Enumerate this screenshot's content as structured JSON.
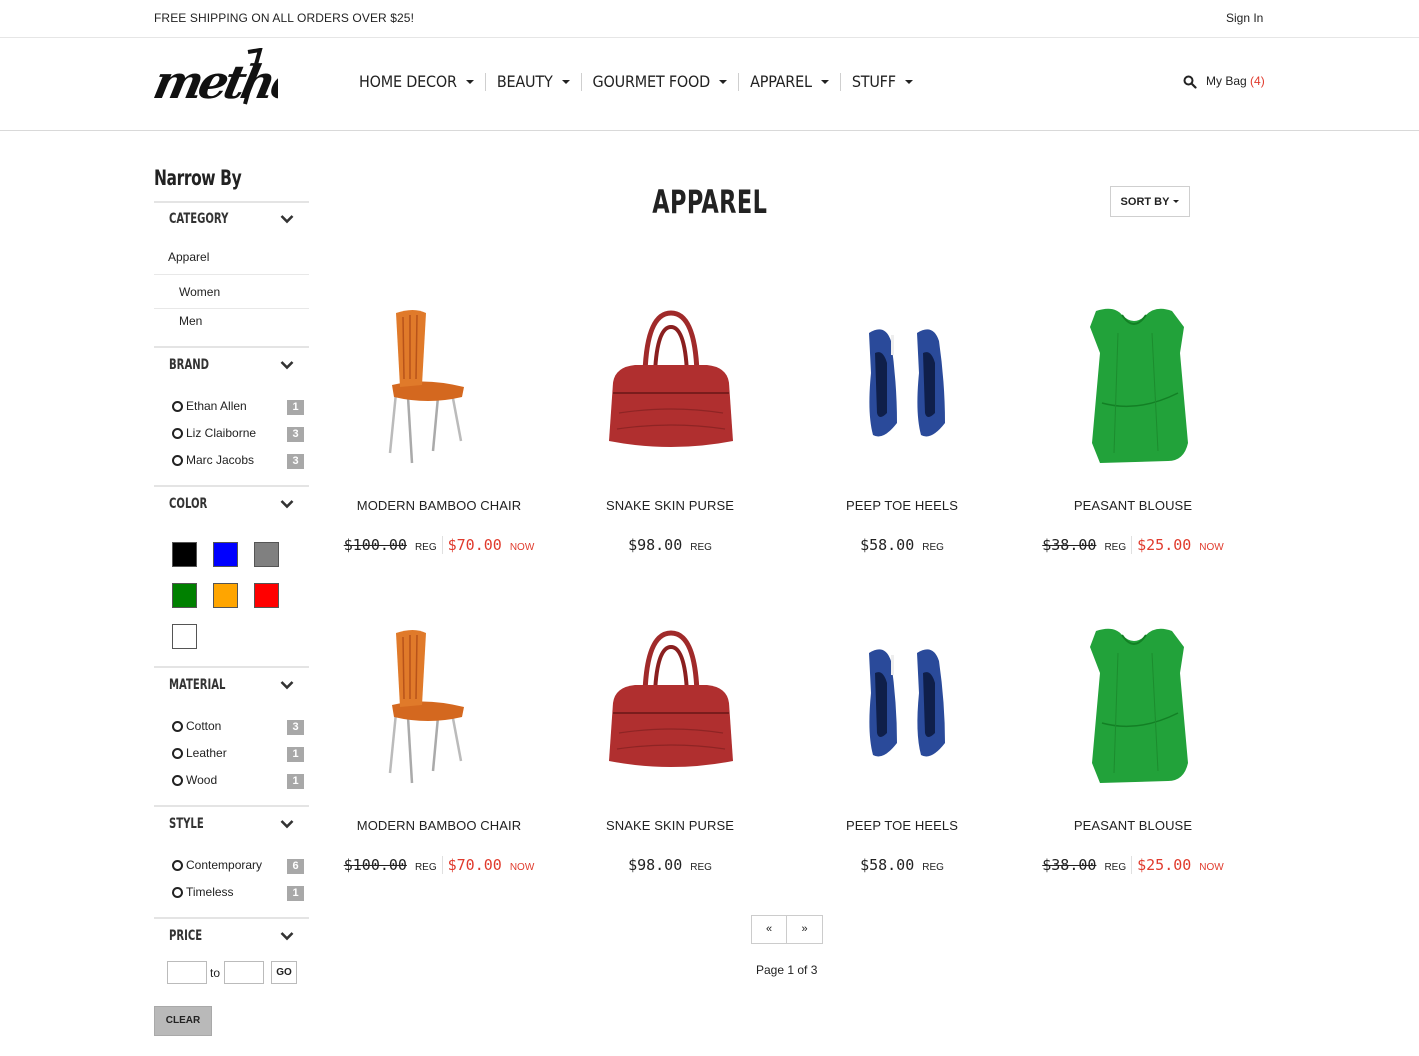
{
  "topbar": {
    "promo": "FREE SHIPPING ON ALL ORDERS OVER $25!",
    "signin": "Sign In"
  },
  "header": {
    "logo_text": "method",
    "nav": [
      "HOME DECOR",
      "BEAUTY",
      "GOURMET FOOD",
      "APPAREL",
      "STUFF"
    ],
    "bag_label": "My Bag",
    "bag_count": "(4)"
  },
  "sidebar": {
    "title": "Narrow By",
    "category": {
      "heading": "CATEGORY",
      "parent": "Apparel",
      "children": [
        "Women",
        "Men"
      ]
    },
    "brand": {
      "heading": "BRAND",
      "items": [
        {
          "label": "Ethan Allen",
          "count": "1"
        },
        {
          "label": "Liz Claiborne",
          "count": "3"
        },
        {
          "label": "Marc Jacobs",
          "count": "3"
        }
      ]
    },
    "color": {
      "heading": "COLOR",
      "swatches": [
        "#000000",
        "#0000ff",
        "#808080",
        "#008000",
        "#ffa500",
        "#ff0000",
        "#ffffff"
      ]
    },
    "material": {
      "heading": "MATERIAL",
      "items": [
        {
          "label": "Cotton",
          "count": "3"
        },
        {
          "label": "Leather",
          "count": "1"
        },
        {
          "label": "Wood",
          "count": "1"
        }
      ]
    },
    "style": {
      "heading": "STYLE",
      "items": [
        {
          "label": "Contemporary",
          "count": "6"
        },
        {
          "label": "Timeless",
          "count": "1"
        }
      ]
    },
    "price": {
      "heading": "PRICE",
      "to_label": "to",
      "go_label": "GO",
      "from_value": "",
      "to_value": ""
    },
    "clear_label": "CLEAR"
  },
  "main": {
    "title": "APPAREL",
    "sort_label": "SORT BY",
    "products": [
      {
        "name": "MODERN BAMBOO CHAIR",
        "reg": "$100.00",
        "reg_label": "REG",
        "sale": "$70.00",
        "now_label": "NOW",
        "image": "chair"
      },
      {
        "name": "SNAKE SKIN PURSE",
        "reg": "$98.00",
        "reg_label": "REG",
        "sale": "",
        "now_label": "",
        "image": "purse"
      },
      {
        "name": "PEEP TOE HEELS",
        "reg": "$58.00",
        "reg_label": "REG",
        "sale": "",
        "now_label": "",
        "image": "heels"
      },
      {
        "name": "PEASANT BLOUSE",
        "reg": "$38.00",
        "reg_label": "REG",
        "sale": "$25.00",
        "now_label": "NOW",
        "image": "blouse"
      },
      {
        "name": "MODERN BAMBOO CHAIR",
        "reg": "$100.00",
        "reg_label": "REG",
        "sale": "$70.00",
        "now_label": "NOW",
        "image": "chair"
      },
      {
        "name": "SNAKE SKIN PURSE",
        "reg": "$98.00",
        "reg_label": "REG",
        "sale": "",
        "now_label": "",
        "image": "purse"
      },
      {
        "name": "PEEP TOE HEELS",
        "reg": "$58.00",
        "reg_label": "REG",
        "sale": "",
        "now_label": "",
        "image": "heels"
      },
      {
        "name": "PEASANT BLOUSE",
        "reg": "$38.00",
        "reg_label": "REG",
        "sale": "$25.00",
        "now_label": "NOW",
        "image": "blouse"
      }
    ],
    "pager": {
      "prev": "«",
      "next": "»",
      "info": "Page 1 of 3"
    }
  },
  "colors": {
    "accent": "#e03a2c",
    "badge": "#a8a8a8"
  }
}
